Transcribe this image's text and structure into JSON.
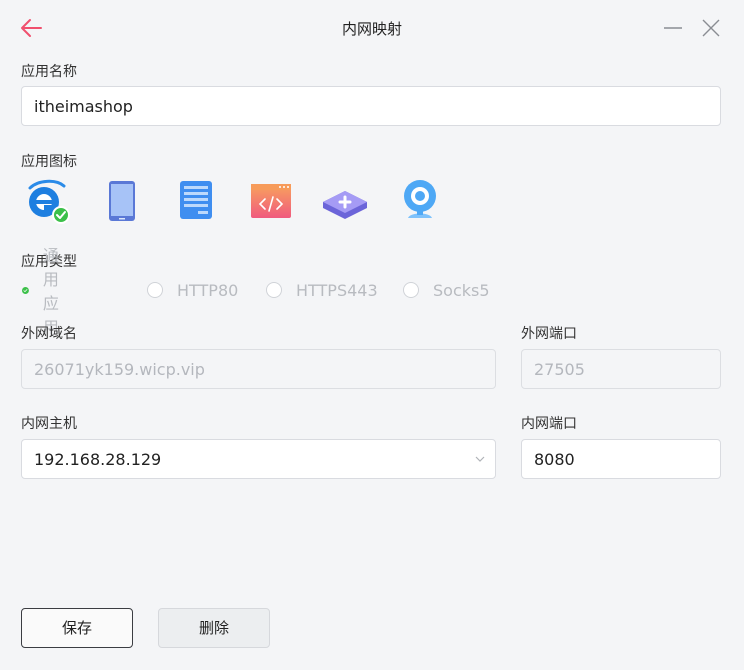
{
  "window": {
    "title": "内网映射"
  },
  "form": {
    "app_name_label": "应用名称",
    "app_name_value": "itheimashop",
    "app_icon_label": "应用图标",
    "app_type_label": "应用类型",
    "app_types": [
      {
        "label": "通用应用",
        "selected": true
      },
      {
        "label": "HTTP80",
        "selected": false
      },
      {
        "label": "HTTPS443",
        "selected": false
      },
      {
        "label": "Socks5",
        "selected": false
      }
    ],
    "ext_domain_label": "外网域名",
    "ext_domain_value": "26071yk159.wicp.vip",
    "ext_port_label": "外网端口",
    "ext_port_value": "27505",
    "int_host_label": "内网主机",
    "int_host_value": "192.168.28.129",
    "int_port_label": "内网端口",
    "int_port_value": "8080"
  },
  "icons": [
    "ie-icon",
    "phone-icon",
    "server-icon",
    "code-window-icon",
    "router-icon",
    "webcam-icon"
  ],
  "buttons": {
    "save": "保存",
    "delete": "删除"
  },
  "colors": {
    "accent_red": "#f0506e",
    "check_green": "#3cc04a",
    "background": "#f4f5f7"
  }
}
